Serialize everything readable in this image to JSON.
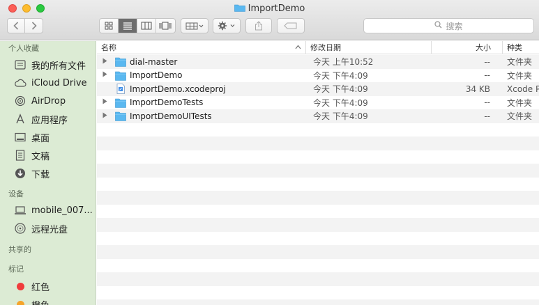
{
  "window": {
    "title": "ImportDemo"
  },
  "toolbar": {
    "back_icon": "chevron-left-icon",
    "forward_icon": "chevron-right-icon",
    "search_placeholder": "搜索"
  },
  "sidebar": {
    "favorites_header": "个人收藏",
    "favorites": [
      {
        "label": "我的所有文件",
        "icon": "all-files-icon"
      },
      {
        "label": "iCloud Drive",
        "icon": "cloud-icon"
      },
      {
        "label": "AirDrop",
        "icon": "airdrop-icon"
      },
      {
        "label": "应用程序",
        "icon": "applications-icon"
      },
      {
        "label": "桌面",
        "icon": "desktop-icon"
      },
      {
        "label": "文稿",
        "icon": "documents-icon"
      },
      {
        "label": "下载",
        "icon": "downloads-icon"
      }
    ],
    "devices_header": "设备",
    "devices": [
      {
        "label": "mobile_007...",
        "icon": "laptop-icon"
      },
      {
        "label": "远程光盘",
        "icon": "disc-icon"
      }
    ],
    "shared_header": "共享的",
    "tags_header": "标记",
    "tags": [
      {
        "label": "红色",
        "color": "#f03c3c"
      },
      {
        "label": "橙色",
        "color": "#f5a42a"
      }
    ]
  },
  "columns": {
    "name": "名称",
    "date": "修改日期",
    "size": "大小",
    "kind": "种类"
  },
  "files": [
    {
      "name": "dial-master",
      "date": "今天 上午10:52",
      "size": "--",
      "kind": "文件夹",
      "type": "folder"
    },
    {
      "name": "ImportDemo",
      "date": "今天 下午4:09",
      "size": "--",
      "kind": "文件夹",
      "type": "folder"
    },
    {
      "name": "ImportDemo.xcodeproj",
      "date": "今天 下午4:09",
      "size": "34 KB",
      "kind": "Xcode P",
      "type": "project"
    },
    {
      "name": "ImportDemoTests",
      "date": "今天 下午4:09",
      "size": "--",
      "kind": "文件夹",
      "type": "folder"
    },
    {
      "name": "ImportDemoUITests",
      "date": "今天 下午4:09",
      "size": "--",
      "kind": "文件夹",
      "type": "folder"
    }
  ],
  "colors": {
    "folder": "#5ab8f0",
    "sidebar_bg": "#dcebd4",
    "selected_segment": "#6d6d6d"
  }
}
